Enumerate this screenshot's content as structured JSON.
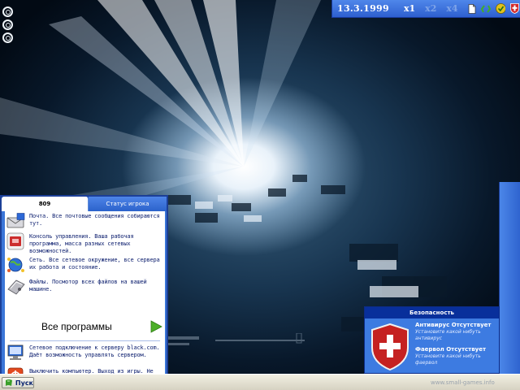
{
  "topbar": {
    "date": "13.3.1999",
    "speeds": [
      {
        "label": "x1",
        "active": true
      },
      {
        "label": "x2",
        "active": false
      },
      {
        "label": "x4",
        "active": false
      }
    ],
    "icons": [
      "document-icon",
      "recycle-icon",
      "antivirus-shield-icon",
      "firewall-shield-icon"
    ]
  },
  "start_menu": {
    "tabs": [
      {
        "label": "809",
        "active": true
      },
      {
        "label": "Статус игрока",
        "active": false
      }
    ],
    "items": [
      {
        "icon": "mail-icon",
        "text": "Почта. Все почтовые сообщения собираются тут."
      },
      {
        "icon": "console-icon",
        "text": "Консоль управления. Ваша рабочая программа, масса разных сетевых возможностей."
      },
      {
        "icon": "network-icon",
        "text": "Сеть. Все сетевое окружение, все сервера их работа и состояние."
      },
      {
        "icon": "files-icon",
        "text": "Файлы. Посмотор всех файлов на вашей машине."
      }
    ],
    "all_programs": "Все программы",
    "bottom_items": [
      {
        "icon": "connection-icon",
        "text": "Сетевое подключение к серверу black.com. Даёт возможность управлять сервером."
      },
      {
        "icon": "shutdown-icon",
        "text": "Выключить компьютер. Выход из игры. Не забудь сохраниться."
      }
    ]
  },
  "security": {
    "title": "Безопасность",
    "antivirus_status": "Антивирус Отсутствует",
    "antivirus_hint": "Установите какой нибуть антивирус",
    "firewall_status": "Фаервол Отсутствует",
    "firewall_hint": "Установите какой нибуть фаервол"
  },
  "taskbar": {
    "start_label": "Пуск"
  },
  "watermark": "www.small-games.info",
  "colors": {
    "menu_blue": "#3b76d8",
    "menu_border": "#1c3f97",
    "item_text": "#0c1e6e",
    "security_title": "#082f9b",
    "shield_red": "#c52121",
    "arrow_green": "#4caf28"
  }
}
